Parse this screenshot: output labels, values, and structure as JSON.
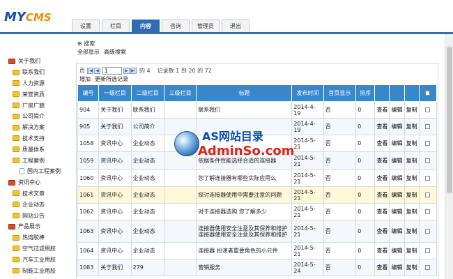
{
  "logo": {
    "my": "MY",
    "cms": "CMS"
  },
  "tabs": [
    "设置",
    "栏目",
    "内容",
    "咨询",
    "管理员",
    "退出"
  ],
  "search": {
    "toggle": "⊞ 搜索",
    "show_all": "全部显示",
    "advanced": "高级搜索"
  },
  "pager": {
    "page_label": "页",
    "page_value": "1",
    "of_label": "的 4",
    "records_text": "记录数 1 到 20 的 72"
  },
  "actions": {
    "add": "增加",
    "update": "更新所选记录"
  },
  "sidebar": [
    {
      "type": "group",
      "label": "关于我们"
    },
    {
      "type": "item",
      "label": "联系我们"
    },
    {
      "type": "item",
      "label": "人力资源"
    },
    {
      "type": "item",
      "label": "荣誉资质"
    },
    {
      "type": "item",
      "label": "厂房厂貌"
    },
    {
      "type": "item",
      "label": "公司简介"
    },
    {
      "type": "item",
      "label": "解决方案"
    },
    {
      "type": "item",
      "label": "技术支持"
    },
    {
      "type": "item",
      "label": "质量体系"
    },
    {
      "type": "item",
      "label": "工程案例"
    },
    {
      "type": "sub",
      "label": "国内工程案例"
    },
    {
      "type": "group",
      "label": "资讯中心"
    },
    {
      "type": "item",
      "label": "技术文章"
    },
    {
      "type": "item",
      "label": "企业动态"
    },
    {
      "type": "item",
      "label": "网站公告"
    },
    {
      "type": "group",
      "label": "产品展示"
    },
    {
      "type": "item",
      "label": "热熔胶棒"
    },
    {
      "type": "item",
      "label": "空气过滤用胶"
    },
    {
      "type": "item",
      "label": "汽车工业用胶"
    },
    {
      "type": "item",
      "label": "制鞋工业用胶"
    }
  ],
  "table": {
    "headers": [
      "编号",
      "一级栏目",
      "二级栏目",
      "三级栏目",
      "标题",
      "发布时间",
      "首页显示",
      "排序",
      "",
      "",
      "",
      ""
    ],
    "rows": [
      {
        "id": "904",
        "l1": "关于我们",
        "l2": "联系我们",
        "l3": "",
        "title": "联系我们",
        "date": "2014-4-19",
        "home": "否",
        "sort": "0",
        "view": "查看",
        "edit": "编辑",
        "copy": "复制",
        "style": "odd"
      },
      {
        "id": "905",
        "l1": "关于我们",
        "l2": "公司简介",
        "l3": "",
        "title": "",
        "date": "2014-4-19",
        "home": "否",
        "sort": "0",
        "view": "查看",
        "edit": "编辑",
        "copy": "复制",
        "style": "even"
      },
      {
        "id": "1058",
        "l1": "资讯中心",
        "l2": "企业动态",
        "l3": "",
        "title": "",
        "date": "2014-5-21",
        "home": "否",
        "sort": "0",
        "view": "查看",
        "edit": "编辑",
        "copy": "复制",
        "style": "odd"
      },
      {
        "id": "1059",
        "l1": "资讯中心",
        "l2": "企业动态",
        "l3": "",
        "title": "依据条件性能选择合适的连接器",
        "date": "2014-5-21",
        "home": "否",
        "sort": "0",
        "view": "查看",
        "edit": "编辑",
        "copy": "复制",
        "style": "even"
      },
      {
        "id": "1060",
        "l1": "资讯中心",
        "l2": "企业动态",
        "l3": "",
        "title": "您了解连接器有哪些实际应用么",
        "date": "2014-5-21",
        "home": "否",
        "sort": "0",
        "view": "查看",
        "edit": "编辑",
        "copy": "复制",
        "style": "odd"
      },
      {
        "id": "1061",
        "l1": "资讯中心",
        "l2": "企业动态",
        "l3": "",
        "title": "探讨连接器使用中需要注意的问题",
        "date": "2014-5-21",
        "home": "否",
        "sort": "0",
        "view": "查看",
        "edit": "编辑",
        "copy": "复制",
        "style": "hl"
      },
      {
        "id": "1062",
        "l1": "资讯中心",
        "l2": "企业动态",
        "l3": "",
        "title": "对于连接器选购 您了解多少",
        "date": "2014-5-21",
        "home": "否",
        "sort": "0",
        "view": "查看",
        "edit": "编辑",
        "copy": "复制",
        "style": "odd"
      },
      {
        "id": "1063",
        "l1": "资讯中心",
        "l2": "企业动态",
        "l3": "",
        "title": "连接器使用安全注意及其保养和维护连接器使用安全注意及其保养和维护",
        "date": "2014-5-21",
        "home": "否",
        "sort": "0",
        "view": "查看",
        "edit": "编辑",
        "copy": "复制",
        "style": "even"
      },
      {
        "id": "1064",
        "l1": "资讯中心",
        "l2": "企业动态",
        "l3": "",
        "title": "连接器 扮演者重要角色的小元件",
        "date": "2014-5-21",
        "home": "否",
        "sort": "0",
        "view": "查看",
        "edit": "编辑",
        "copy": "复制",
        "style": "odd"
      },
      {
        "id": "1083",
        "l1": "关于我们",
        "l2": "279",
        "l3": "",
        "title": "营销服务",
        "date": "2014-5-24",
        "home": "否",
        "sort": "0",
        "view": "查看",
        "edit": "编辑",
        "copy": "复制",
        "style": "even"
      }
    ]
  },
  "watermark": {
    "top": "AS网站目录",
    "bottom": "AdminSo.com"
  },
  "colors": {
    "accent": "#2f6cb4",
    "header_bg": "#3b86c8",
    "highlight_row": "#fdf9d8",
    "logo_orange": "#f08a00"
  }
}
